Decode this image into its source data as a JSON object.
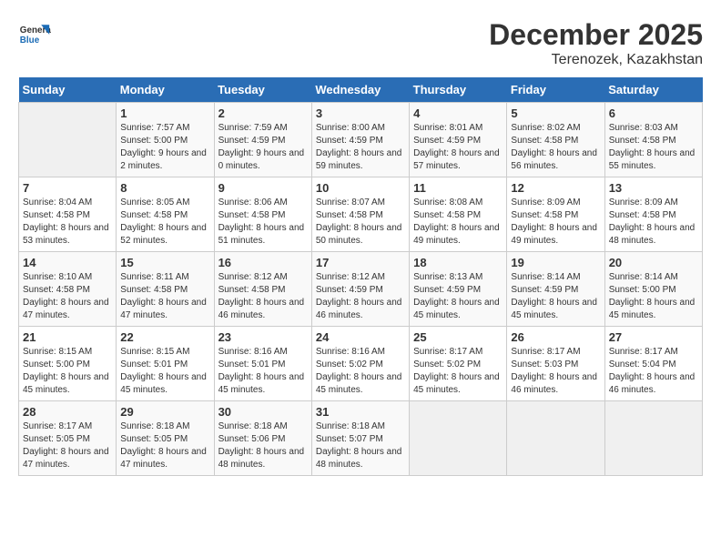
{
  "header": {
    "logo_line1": "General",
    "logo_line2": "Blue",
    "month_title": "December 2025",
    "location": "Terenozek, Kazakhstan"
  },
  "days_of_week": [
    "Sunday",
    "Monday",
    "Tuesday",
    "Wednesday",
    "Thursday",
    "Friday",
    "Saturday"
  ],
  "weeks": [
    [
      {
        "day": "",
        "sunrise": "",
        "sunset": "",
        "daylight": ""
      },
      {
        "day": "1",
        "sunrise": "Sunrise: 7:57 AM",
        "sunset": "Sunset: 5:00 PM",
        "daylight": "Daylight: 9 hours and 2 minutes."
      },
      {
        "day": "2",
        "sunrise": "Sunrise: 7:59 AM",
        "sunset": "Sunset: 4:59 PM",
        "daylight": "Daylight: 9 hours and 0 minutes."
      },
      {
        "day": "3",
        "sunrise": "Sunrise: 8:00 AM",
        "sunset": "Sunset: 4:59 PM",
        "daylight": "Daylight: 8 hours and 59 minutes."
      },
      {
        "day": "4",
        "sunrise": "Sunrise: 8:01 AM",
        "sunset": "Sunset: 4:59 PM",
        "daylight": "Daylight: 8 hours and 57 minutes."
      },
      {
        "day": "5",
        "sunrise": "Sunrise: 8:02 AM",
        "sunset": "Sunset: 4:58 PM",
        "daylight": "Daylight: 8 hours and 56 minutes."
      },
      {
        "day": "6",
        "sunrise": "Sunrise: 8:03 AM",
        "sunset": "Sunset: 4:58 PM",
        "daylight": "Daylight: 8 hours and 55 minutes."
      }
    ],
    [
      {
        "day": "7",
        "sunrise": "Sunrise: 8:04 AM",
        "sunset": "Sunset: 4:58 PM",
        "daylight": "Daylight: 8 hours and 53 minutes."
      },
      {
        "day": "8",
        "sunrise": "Sunrise: 8:05 AM",
        "sunset": "Sunset: 4:58 PM",
        "daylight": "Daylight: 8 hours and 52 minutes."
      },
      {
        "day": "9",
        "sunrise": "Sunrise: 8:06 AM",
        "sunset": "Sunset: 4:58 PM",
        "daylight": "Daylight: 8 hours and 51 minutes."
      },
      {
        "day": "10",
        "sunrise": "Sunrise: 8:07 AM",
        "sunset": "Sunset: 4:58 PM",
        "daylight": "Daylight: 8 hours and 50 minutes."
      },
      {
        "day": "11",
        "sunrise": "Sunrise: 8:08 AM",
        "sunset": "Sunset: 4:58 PM",
        "daylight": "Daylight: 8 hours and 49 minutes."
      },
      {
        "day": "12",
        "sunrise": "Sunrise: 8:09 AM",
        "sunset": "Sunset: 4:58 PM",
        "daylight": "Daylight: 8 hours and 49 minutes."
      },
      {
        "day": "13",
        "sunrise": "Sunrise: 8:09 AM",
        "sunset": "Sunset: 4:58 PM",
        "daylight": "Daylight: 8 hours and 48 minutes."
      }
    ],
    [
      {
        "day": "14",
        "sunrise": "Sunrise: 8:10 AM",
        "sunset": "Sunset: 4:58 PM",
        "daylight": "Daylight: 8 hours and 47 minutes."
      },
      {
        "day": "15",
        "sunrise": "Sunrise: 8:11 AM",
        "sunset": "Sunset: 4:58 PM",
        "daylight": "Daylight: 8 hours and 47 minutes."
      },
      {
        "day": "16",
        "sunrise": "Sunrise: 8:12 AM",
        "sunset": "Sunset: 4:58 PM",
        "daylight": "Daylight: 8 hours and 46 minutes."
      },
      {
        "day": "17",
        "sunrise": "Sunrise: 8:12 AM",
        "sunset": "Sunset: 4:59 PM",
        "daylight": "Daylight: 8 hours and 46 minutes."
      },
      {
        "day": "18",
        "sunrise": "Sunrise: 8:13 AM",
        "sunset": "Sunset: 4:59 PM",
        "daylight": "Daylight: 8 hours and 45 minutes."
      },
      {
        "day": "19",
        "sunrise": "Sunrise: 8:14 AM",
        "sunset": "Sunset: 4:59 PM",
        "daylight": "Daylight: 8 hours and 45 minutes."
      },
      {
        "day": "20",
        "sunrise": "Sunrise: 8:14 AM",
        "sunset": "Sunset: 5:00 PM",
        "daylight": "Daylight: 8 hours and 45 minutes."
      }
    ],
    [
      {
        "day": "21",
        "sunrise": "Sunrise: 8:15 AM",
        "sunset": "Sunset: 5:00 PM",
        "daylight": "Daylight: 8 hours and 45 minutes."
      },
      {
        "day": "22",
        "sunrise": "Sunrise: 8:15 AM",
        "sunset": "Sunset: 5:01 PM",
        "daylight": "Daylight: 8 hours and 45 minutes."
      },
      {
        "day": "23",
        "sunrise": "Sunrise: 8:16 AM",
        "sunset": "Sunset: 5:01 PM",
        "daylight": "Daylight: 8 hours and 45 minutes."
      },
      {
        "day": "24",
        "sunrise": "Sunrise: 8:16 AM",
        "sunset": "Sunset: 5:02 PM",
        "daylight": "Daylight: 8 hours and 45 minutes."
      },
      {
        "day": "25",
        "sunrise": "Sunrise: 8:17 AM",
        "sunset": "Sunset: 5:02 PM",
        "daylight": "Daylight: 8 hours and 45 minutes."
      },
      {
        "day": "26",
        "sunrise": "Sunrise: 8:17 AM",
        "sunset": "Sunset: 5:03 PM",
        "daylight": "Daylight: 8 hours and 46 minutes."
      },
      {
        "day": "27",
        "sunrise": "Sunrise: 8:17 AM",
        "sunset": "Sunset: 5:04 PM",
        "daylight": "Daylight: 8 hours and 46 minutes."
      }
    ],
    [
      {
        "day": "28",
        "sunrise": "Sunrise: 8:17 AM",
        "sunset": "Sunset: 5:05 PM",
        "daylight": "Daylight: 8 hours and 47 minutes."
      },
      {
        "day": "29",
        "sunrise": "Sunrise: 8:18 AM",
        "sunset": "Sunset: 5:05 PM",
        "daylight": "Daylight: 8 hours and 47 minutes."
      },
      {
        "day": "30",
        "sunrise": "Sunrise: 8:18 AM",
        "sunset": "Sunset: 5:06 PM",
        "daylight": "Daylight: 8 hours and 48 minutes."
      },
      {
        "day": "31",
        "sunrise": "Sunrise: 8:18 AM",
        "sunset": "Sunset: 5:07 PM",
        "daylight": "Daylight: 8 hours and 48 minutes."
      },
      {
        "day": "",
        "sunrise": "",
        "sunset": "",
        "daylight": ""
      },
      {
        "day": "",
        "sunrise": "",
        "sunset": "",
        "daylight": ""
      },
      {
        "day": "",
        "sunrise": "",
        "sunset": "",
        "daylight": ""
      }
    ]
  ]
}
